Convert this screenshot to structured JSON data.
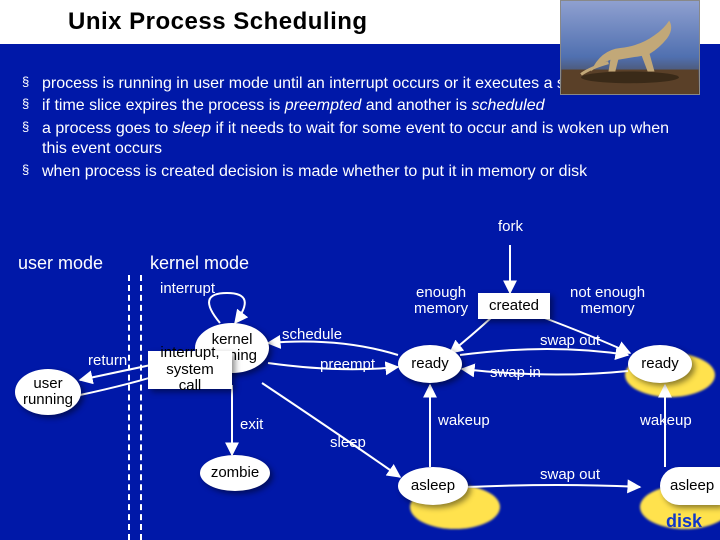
{
  "title": "Unix Process Scheduling",
  "bullets": [
    "process is running in user mode until an interrupt occurs or it executes a system call",
    "if time slice expires the process is <i>preempted</i> and another is <i>scheduled</i>",
    "a process goes to <i>sleep</i> if it needs to wait for some event to occur and is woken up when this event occurs",
    "when process is created  decision is made whether to put it in memory or disk"
  ],
  "modes": {
    "user": "user mode",
    "kernel": "kernel mode"
  },
  "states": {
    "user_running": "user\nrunning",
    "kernel_running": "kernel\nrunning",
    "zombie": "zombie",
    "ready_mem": "ready",
    "created": "created",
    "ready_disk": "ready",
    "asleep_mem": "asleep",
    "asleep_disk": "asleep",
    "intcall": "interrupt,\nsystem call"
  },
  "edges": {
    "fork": "fork",
    "interrupt": "interrupt",
    "return": "return",
    "schedule": "schedule",
    "preempt": "preempt",
    "exit": "exit",
    "sleep": "sleep",
    "enough_mem": "enough\nmemory",
    "not_enough_mem": "not enough\nmemory",
    "swap_out_top": "swap out",
    "swap_in": "swap in",
    "wakeup_left": "wakeup",
    "wakeup_right": "wakeup",
    "swap_out_bot": "swap out"
  },
  "disk_label": "disk"
}
